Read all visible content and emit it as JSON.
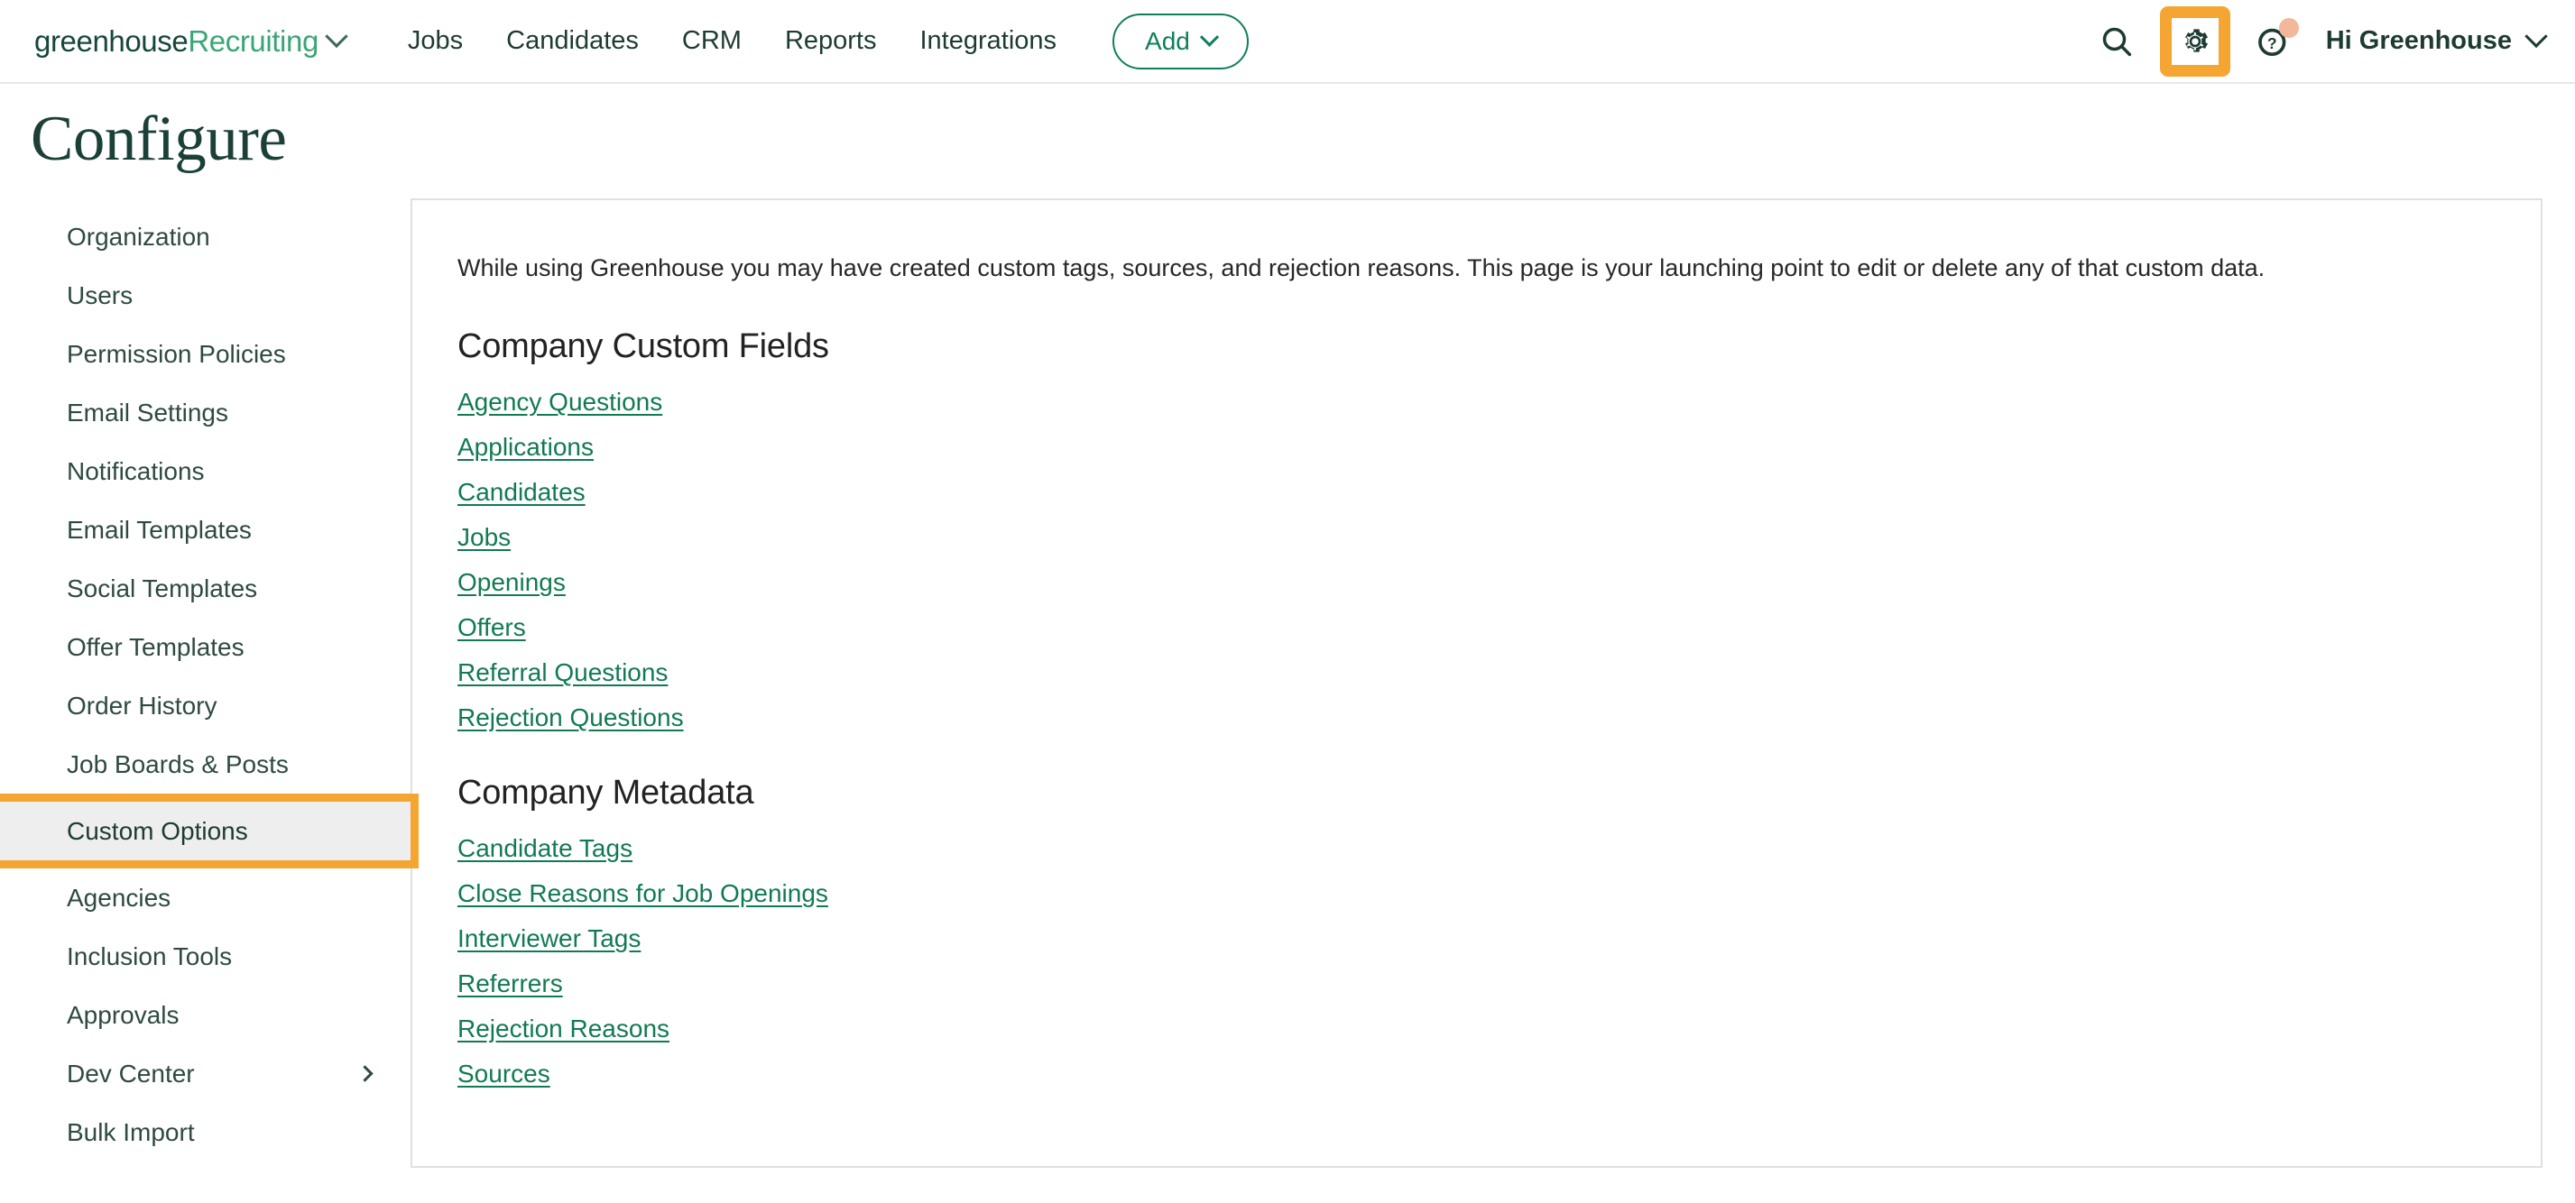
{
  "header": {
    "logo": {
      "primary": "greenhouse",
      "secondary": "Recruiting",
      "chevron_icon": "chevron-down-icon"
    },
    "nav": [
      {
        "label": "Jobs"
      },
      {
        "label": "Candidates"
      },
      {
        "label": "CRM"
      },
      {
        "label": "Reports"
      },
      {
        "label": "Integrations"
      }
    ],
    "add_button": {
      "label": "Add",
      "chevron_icon": "chevron-down-icon"
    },
    "search_icon": "search-icon",
    "settings_icon": "gear-icon",
    "help_icon": "question-mark-icon",
    "notification_dot": true,
    "user": {
      "label": "Hi Greenhouse",
      "chevron_icon": "chevron-down-icon"
    }
  },
  "page": {
    "title": "Configure"
  },
  "sidebar": {
    "items": [
      {
        "label": "Organization",
        "active": false,
        "has_chevron": false
      },
      {
        "label": "Users",
        "active": false,
        "has_chevron": false
      },
      {
        "label": "Permission Policies",
        "active": false,
        "has_chevron": false
      },
      {
        "label": "Email Settings",
        "active": false,
        "has_chevron": false
      },
      {
        "label": "Notifications",
        "active": false,
        "has_chevron": false
      },
      {
        "label": "Email Templates",
        "active": false,
        "has_chevron": false
      },
      {
        "label": "Social Templates",
        "active": false,
        "has_chevron": false
      },
      {
        "label": "Offer Templates",
        "active": false,
        "has_chevron": false
      },
      {
        "label": "Order History",
        "active": false,
        "has_chevron": false
      },
      {
        "label": "Job Boards & Posts",
        "active": false,
        "has_chevron": false
      },
      {
        "label": "Custom Options",
        "active": true,
        "has_chevron": false
      },
      {
        "label": "Agencies",
        "active": false,
        "has_chevron": false
      },
      {
        "label": "Inclusion Tools",
        "active": false,
        "has_chevron": false
      },
      {
        "label": "Approvals",
        "active": false,
        "has_chevron": false
      },
      {
        "label": "Dev Center",
        "active": false,
        "has_chevron": true
      },
      {
        "label": "Bulk Import",
        "active": false,
        "has_chevron": false
      }
    ]
  },
  "main": {
    "intro": "While using Greenhouse you may have created custom tags, sources, and rejection reasons. This page is your launching point to edit or delete any of that custom data.",
    "sections": [
      {
        "heading": "Company Custom Fields",
        "links": [
          "Agency Questions",
          "Applications",
          "Candidates",
          "Jobs",
          "Openings",
          "Offers",
          "Referral Questions",
          "Rejection Questions"
        ]
      },
      {
        "heading": "Company Metadata",
        "links": [
          "Candidate Tags",
          "Close Reasons for Job Openings",
          "Interviewer Tags",
          "Referrers",
          "Rejection Reasons",
          "Sources"
        ]
      }
    ]
  },
  "colors": {
    "brand_green": "#0e7f5c",
    "dark_green": "#1d3b33",
    "link_green": "#117a53",
    "accent_orange": "#f5a531",
    "notification_peach": "#f3b79a"
  }
}
